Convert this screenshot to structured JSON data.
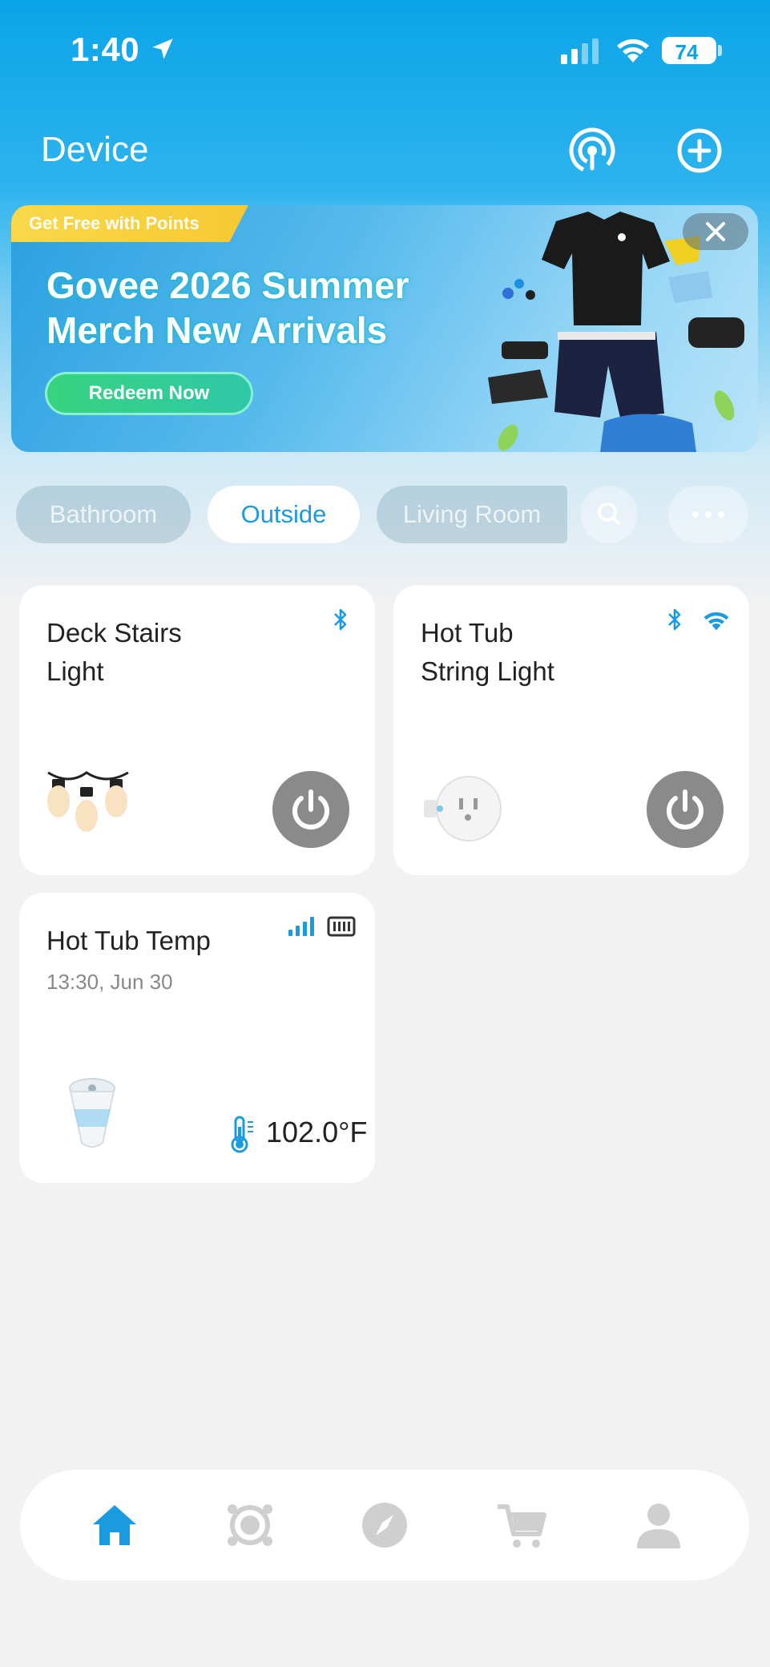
{
  "status_bar": {
    "time": "1:40",
    "battery": "74",
    "icons": [
      "location-arrow-icon",
      "cellular-signal-icon",
      "wifi-icon",
      "battery-icon"
    ]
  },
  "header": {
    "title": "Device",
    "icons": [
      "broadcast-icon",
      "add-circle-icon"
    ]
  },
  "banner": {
    "ribbon": "Get Free with Points",
    "title_line1": "Govee 2026 Summer",
    "title_line2": "Merch New Arrivals",
    "cta": "Redeem Now",
    "close_icon": "close-icon"
  },
  "tabs": {
    "items": [
      {
        "label": "Bathroom",
        "active": false
      },
      {
        "label": "Outside",
        "active": true
      },
      {
        "label": "Living Room",
        "active": false
      }
    ],
    "search_icon": "search-icon",
    "more_icon": "more-dots-icon"
  },
  "devices": [
    {
      "name_line1": "Deck Stairs",
      "name_line2": "Light",
      "status_icons": [
        "bluetooth-icon"
      ],
      "image": "string-light-bulbs-icon",
      "control": "power-icon"
    },
    {
      "name_line1": "Hot Tub",
      "name_line2": "String Light",
      "status_icons": [
        "bluetooth-icon",
        "wifi-icon"
      ],
      "image": "smart-plug-icon",
      "control": "power-icon"
    },
    {
      "name_line1": "Hot Tub Temp",
      "subtitle": "13:30,  Jun 30",
      "status_icons": [
        "signal-icon",
        "battery-full-icon"
      ],
      "image": "pool-thermometer-icon",
      "reading_icon": "thermometer-icon",
      "reading": "102.0°F"
    }
  ],
  "bottom_nav": {
    "items": [
      {
        "name": "home-icon",
        "active": true
      },
      {
        "name": "scenes-icon",
        "active": false
      },
      {
        "name": "discover-compass-icon",
        "active": false
      },
      {
        "name": "shop-cart-icon",
        "active": false
      },
      {
        "name": "profile-icon",
        "active": false
      }
    ]
  },
  "colors": {
    "accent": "#1a9be0",
    "header_bg": "#0ba4e8",
    "power_off": "#8a8a8a",
    "page_bg": "#f2f2f2",
    "bluetooth": "#1a9be0"
  }
}
